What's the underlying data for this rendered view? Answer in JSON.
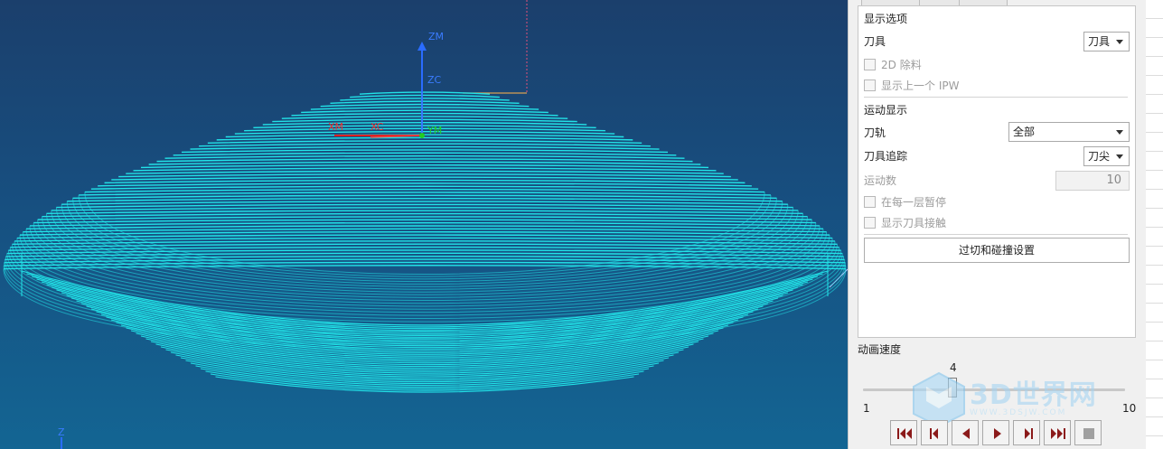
{
  "viewport": {
    "axis_labels": {
      "zm": "ZM",
      "zc": "ZC",
      "xm": "XM",
      "xc": "XC",
      "ym": "YM",
      "z": "Z"
    },
    "toolpath_color": "#22e3e8",
    "background_top": "#1b3f6c",
    "background_bottom": "#136593"
  },
  "panel": {
    "section_display": "显示选项",
    "tool_label": "刀具",
    "tool_select": "刀具",
    "chk_2d_removal": "2D 除料",
    "chk_prev_ipw": "显示上一个 IPW",
    "section_motion": "运动显示",
    "path_label": "刀轨",
    "path_select": "全部",
    "trace_label": "刀具追踪",
    "trace_select": "刀尖",
    "motion_count_label": "运动数",
    "motion_count_value": "10",
    "chk_pause_layer": "在每一层暂停",
    "chk_show_contact": "显示刀具接触",
    "collision_button": "过切和碰撞设置"
  },
  "animation": {
    "title": "动画速度",
    "value": "4",
    "min": "1",
    "max": "10",
    "speed": 4,
    "speed_min": 1,
    "speed_max": 10
  },
  "watermark": {
    "text": "3D世界网",
    "url": "WWW.3DSJW.COM"
  },
  "playback": {
    "buttons": [
      "rewind-to-start",
      "step-back",
      "play-reverse",
      "play-forward",
      "step-forward",
      "fast-forward",
      "stop"
    ],
    "icon_color": "#8b1a1a"
  }
}
